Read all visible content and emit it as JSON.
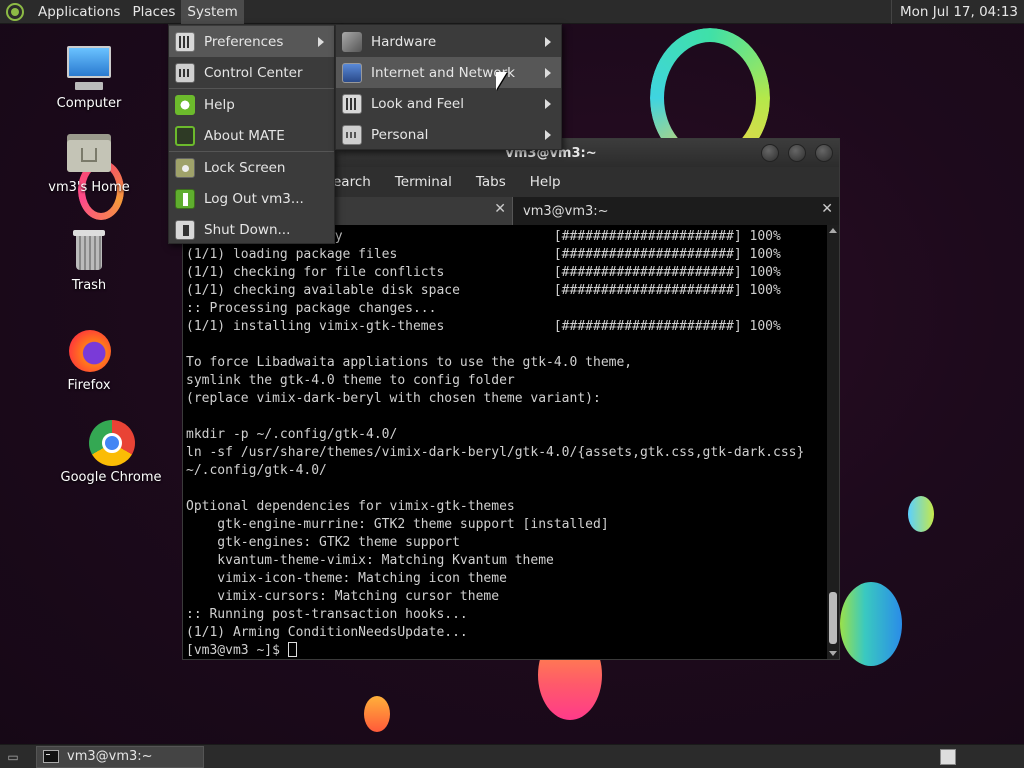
{
  "top_panel": {
    "menus": [
      "Applications",
      "Places",
      "System"
    ],
    "clock": "Mon Jul 17, 04:13"
  },
  "desktop_icons": [
    {
      "label": "Computer",
      "icon": "computer-icon"
    },
    {
      "label": "vm3's Home",
      "icon": "home-folder-icon"
    },
    {
      "label": "Trash",
      "icon": "trash-icon"
    },
    {
      "label": "Firefox",
      "icon": "firefox-icon"
    },
    {
      "label": "Google Chrome",
      "icon": "chrome-icon"
    }
  ],
  "system_menu": {
    "items": [
      {
        "label": "Preferences",
        "icon": "preferences-icon",
        "submenu": true
      },
      {
        "label": "Control Center",
        "icon": "control-center-icon"
      },
      {
        "label": "Help",
        "icon": "help-icon"
      },
      {
        "label": "About MATE",
        "icon": "about-icon"
      },
      {
        "label": "Lock Screen",
        "icon": "lock-icon"
      },
      {
        "label": "Log Out vm3...",
        "icon": "logout-icon"
      },
      {
        "label": "Shut Down...",
        "icon": "shutdown-icon"
      }
    ]
  },
  "preferences_menu": {
    "items": [
      {
        "label": "Hardware",
        "icon": "hardware-icon"
      },
      {
        "label": "Internet and Network",
        "icon": "network-icon"
      },
      {
        "label": "Look and Feel",
        "icon": "look-feel-icon"
      },
      {
        "label": "Personal",
        "icon": "personal-icon"
      }
    ]
  },
  "terminal": {
    "title": "vm3@vm3:~",
    "menus": [
      "earch",
      "Terminal",
      "Tabs",
      "Help"
    ],
    "tabs": [
      {
        "label": "",
        "active": false
      },
      {
        "label": "vm3@vm3:~",
        "active": true
      }
    ],
    "lines": [
      "      kage integrity                           [######################] 100%",
      "(1/1) loading package files                    [######################] 100%",
      "(1/1) checking for file conflicts              [######################] 100%",
      "(1/1) checking available disk space            [######################] 100%",
      ":: Processing package changes...",
      "(1/1) installing vimix-gtk-themes              [######################] 100%",
      "",
      "To force Libadwaita appliations to use the gtk-4.0 theme,",
      "symlink the gtk-4.0 theme to config folder",
      "(replace vimix-dark-beryl with chosen theme variant):",
      "",
      "mkdir -p ~/.config/gtk-4.0/",
      "ln -sf /usr/share/themes/vimix-dark-beryl/gtk-4.0/{assets,gtk.css,gtk-dark.css}",
      "~/.config/gtk-4.0/",
      "",
      "Optional dependencies for vimix-gtk-themes",
      "    gtk-engine-murrine: GTK2 theme support [installed]",
      "    gtk-engines: GTK2 theme support",
      "    kvantum-theme-vimix: Matching Kvantum theme",
      "    vimix-icon-theme: Matching icon theme",
      "    vimix-cursors: Matching cursor theme",
      ":: Running post-transaction hooks...",
      "(1/1) Arming ConditionNeedsUpdate..."
    ],
    "prompt": "[vm3@vm3 ~]$ "
  },
  "taskbar": {
    "window_button": "vm3@vm3:~"
  },
  "colors": {
    "panel": "#2b2b2b",
    "menu": "#3b3b3b",
    "menu_highlight": "#575757",
    "terminal_bg": "#000000",
    "accent_green": "#8dbb45"
  }
}
